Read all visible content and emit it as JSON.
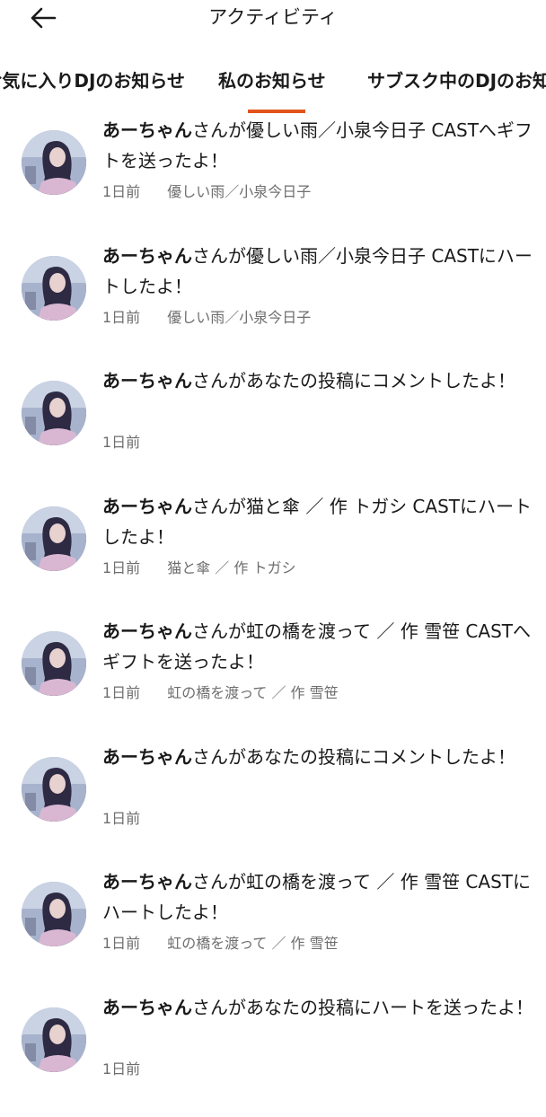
{
  "header": {
    "back_icon": "arrow-left-icon",
    "title": "アクティビティ"
  },
  "tabs": {
    "fav": "お気に入りDJのお知らせ",
    "mine": "私のお知らせ",
    "subs": "サブスク中のDJのお知らせ",
    "active": "mine",
    "indicator_color": "#e2541a"
  },
  "notifications": [
    {
      "name": "あーちゃん",
      "message": "さんが優しい雨／小泉今日子 CASTへギフトを送ったよ！",
      "time": "1日前",
      "work": "優しい雨／小泉今日子"
    },
    {
      "name": "あーちゃん",
      "message": "さんが優しい雨／小泉今日子 CASTにハートしたよ！",
      "time": "1日前",
      "work": "優しい雨／小泉今日子"
    },
    {
      "name": "あーちゃん",
      "message": "さんがあなたの投稿にコメントしたよ！",
      "time": "1日前",
      "work": ""
    },
    {
      "name": "あーちゃん",
      "message": "さんが猫と傘 ／ 作 トガシ CASTにハートしたよ！",
      "time": "1日前",
      "work": "猫と傘 ／ 作 トガシ"
    },
    {
      "name": "あーちゃん",
      "message": "さんが虹の橋を渡って ／ 作 雪笹 CASTへギフトを送ったよ！",
      "time": "1日前",
      "work": "虹の橋を渡って ／ 作 雪笹"
    },
    {
      "name": "あーちゃん",
      "message": "さんがあなたの投稿にコメントしたよ！",
      "time": "1日前",
      "work": ""
    },
    {
      "name": "あーちゃん",
      "message": "さんが虹の橋を渡って ／ 作 雪笹 CASTにハートしたよ！",
      "time": "1日前",
      "work": "虹の橋を渡って ／ 作 雪笹"
    },
    {
      "name": "あーちゃん",
      "message": "さんがあなたの投稿にハートを送ったよ！",
      "time": "1日前",
      "work": ""
    }
  ]
}
